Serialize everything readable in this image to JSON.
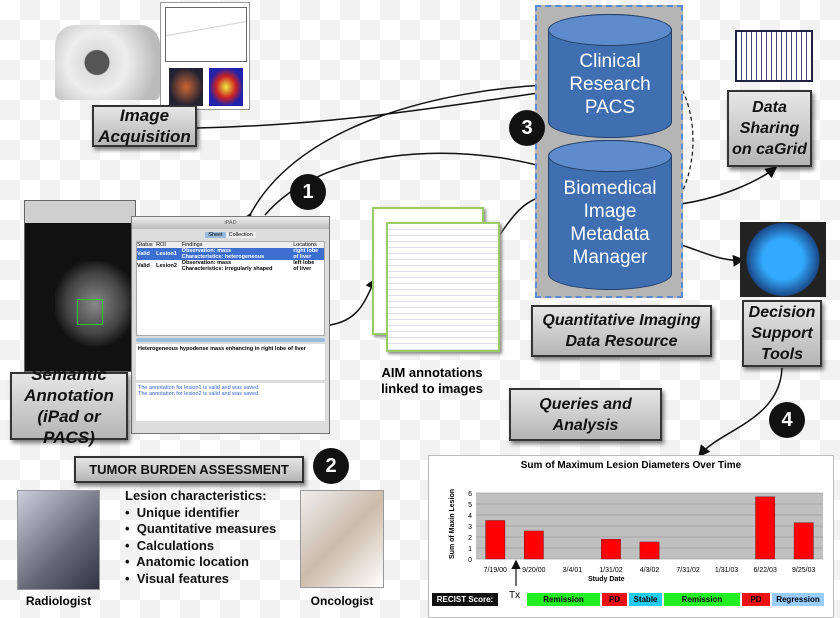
{
  "labels": {
    "image_acquisition": "Image Acquisition",
    "semantic_annotation": "Semantic Annotation (iPad or PACS)",
    "aim": "AIM annotations linked to images",
    "pacs": "Clinical Research PACS",
    "biomedical": "Biomedical Image Metadata Manager",
    "qidr": "Quantitative Imaging Data Resource",
    "data_sharing": "Data Sharing on caGrid",
    "decision": "Decision Support Tools",
    "queries": "Queries and Analysis",
    "tumor": "TUMOR BURDEN ASSESSMENT",
    "radiologist": "Radiologist",
    "oncologist": "Oncologist"
  },
  "steps": [
    "1",
    "2",
    "3",
    "4"
  ],
  "lesion_list": {
    "title": "Lesion characteristics:",
    "items": [
      "Unique identifier",
      "Quantitative measures",
      "Calculations",
      "Anatomic location",
      "Visual features"
    ]
  },
  "ipad": {
    "title": "iPAD",
    "tabs": [
      "Sheet",
      "Collection"
    ],
    "columns": [
      "Status",
      "ROI",
      "Findings",
      "Locations"
    ],
    "rows": [
      {
        "status": "Valid",
        "roi": "Lesion1",
        "f1": "Observation: mass",
        "f2": "Characteristics: heterogeneous",
        "l1": "right lobe",
        "l2": "of liver"
      },
      {
        "status": "Valid",
        "roi": "Lesion2",
        "f1": "Observation: mass",
        "f2": "Characteristics: irregularly shaped",
        "l1": "left lobe",
        "l2": "of liver"
      }
    ],
    "description": "Heterogeneous hypodense mass enhancing in right lobe of liver",
    "messages": [
      "The annotation for lesion1 is valid and was saved.",
      "The annotation for lesion2 is valid and was saved."
    ]
  },
  "chart_data": {
    "type": "bar",
    "title": "Sum of Maximum Lesion Diameters Over Time",
    "xlabel": "Study Date",
    "ylabel": "Sum of Maxin Lesion",
    "categories": [
      "7/19/00",
      "9/20/00",
      "3/4/01",
      "1/31/02",
      "4/3/02",
      "7/31/02",
      "1/31/03",
      "6/22/03",
      "9/25/03"
    ],
    "values": [
      3.5,
      2.55,
      0,
      1.8,
      1.55,
      0,
      0,
      5.65,
      3.3
    ],
    "ylim": [
      0,
      6
    ],
    "yticks": [
      "0",
      "1",
      "2",
      "3",
      "4",
      "5",
      "6"
    ],
    "grid": true,
    "bar_color": "#ff0000",
    "marker": "Tx",
    "recist_label": "RECIST Score:",
    "recist": [
      {
        "label": "Remission",
        "color": "#22ee22"
      },
      {
        "label": "PD",
        "color": "#ee1111"
      },
      {
        "label": "Stable",
        "color": "#22ccee"
      },
      {
        "label": "Remission",
        "color": "#22ee22"
      },
      {
        "label": "PD",
        "color": "#ee1111"
      },
      {
        "label": "Regression",
        "color": "#99ccff"
      }
    ]
  }
}
